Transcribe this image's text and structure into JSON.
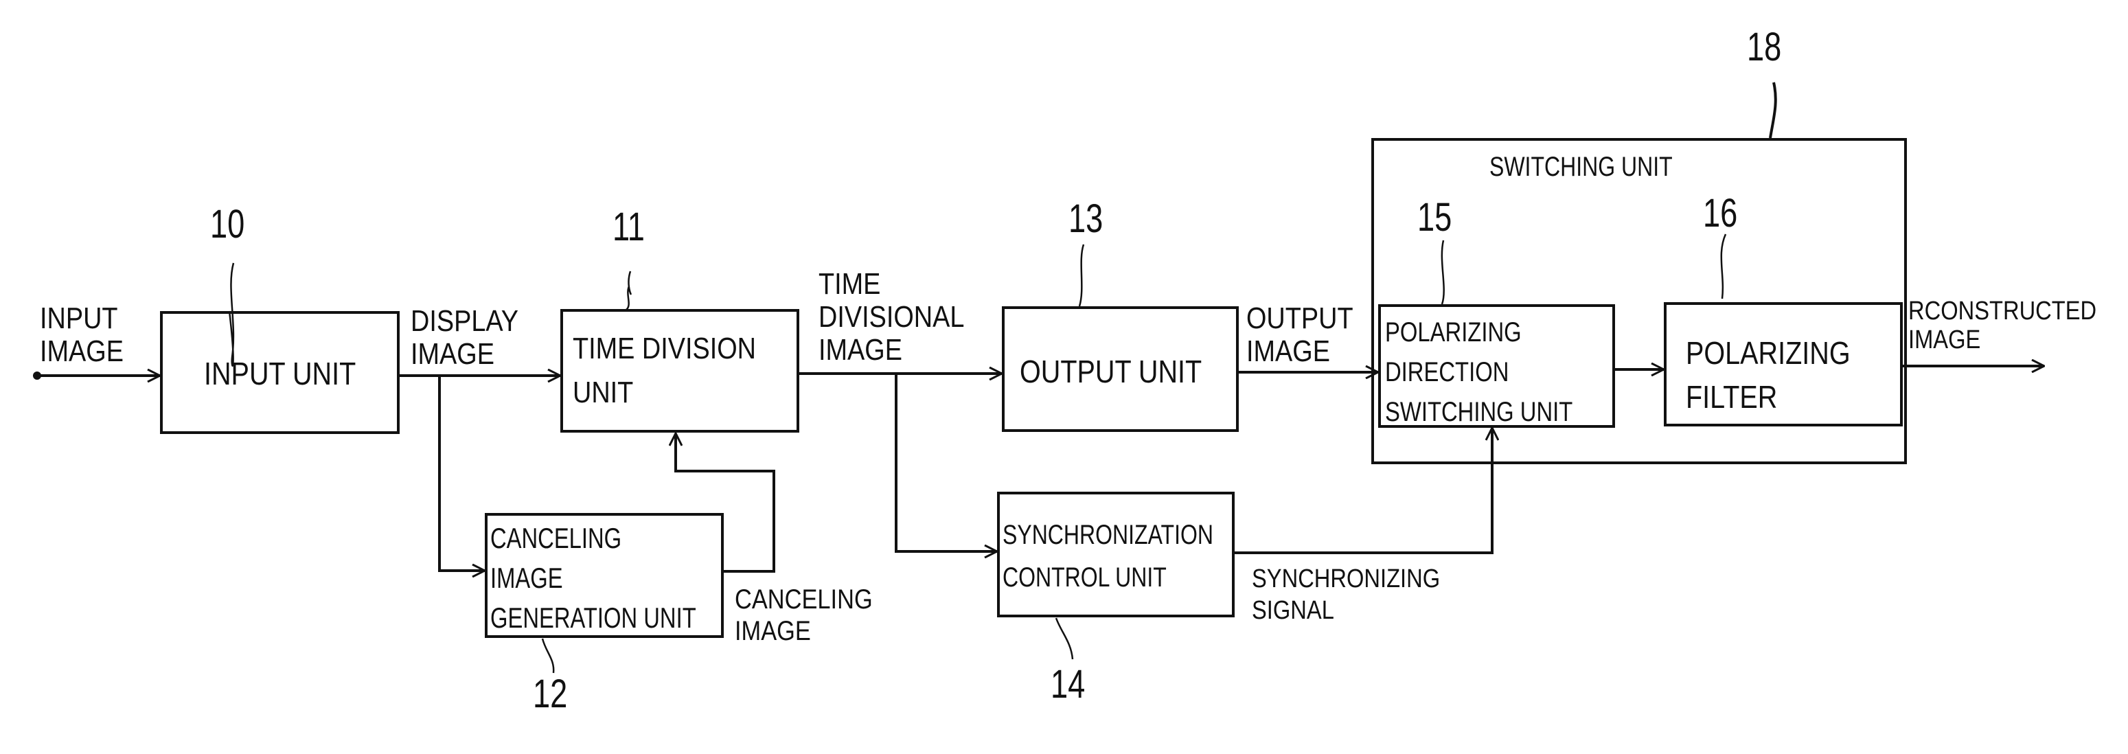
{
  "figure": {
    "blocks": {
      "input_unit": {
        "ref": "10",
        "text": "INPUT UNIT"
      },
      "time_division_unit": {
        "ref": "11",
        "text": "TIME DIVISION\nUNIT"
      },
      "canceling_image_generation_unit": {
        "ref": "12",
        "text": "CANCELING\nIMAGE\nGENERATION UNIT"
      },
      "output_unit": {
        "ref": "13",
        "text": "OUTPUT UNIT"
      },
      "synchronization_control_unit": {
        "ref": "14",
        "text": "SYNCHRONIZATION\nCONTROL UNIT"
      },
      "polarizing_direction_switching_unit": {
        "ref": "15",
        "text": "POLARIZING\nDIRECTION\nSWITCHING UNIT"
      },
      "polarizing_filter": {
        "ref": "16",
        "text": "POLARIZING\nFILTER"
      },
      "switching_unit": {
        "ref": "18",
        "text": "SWITCHING UNIT"
      }
    },
    "signals": {
      "input_image": "INPUT\nIMAGE",
      "display_image": "DISPLAY\nIMAGE",
      "time_divisional_image": "TIME\nDIVISIONAL\nIMAGE",
      "output_image": "OUTPUT\nIMAGE",
      "reconstructed_image": "RCONSTRUCTED\nIMAGE",
      "canceling_image": "CANCELING\nIMAGE",
      "synchronizing_signal": "SYNCHRONIZING\nSIGNAL"
    }
  }
}
